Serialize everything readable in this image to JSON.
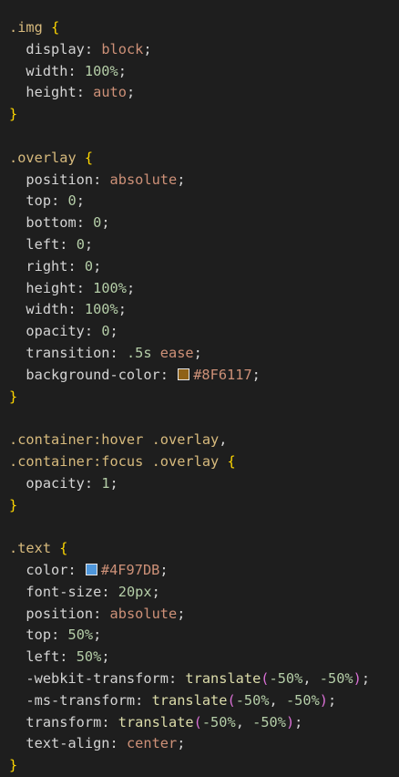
{
  "editor": {
    "lines": [
      [
        {
          "t": ".img",
          "c": "selector"
        },
        {
          "t": " ",
          "c": "punct"
        },
        {
          "t": "{",
          "c": "brace"
        }
      ],
      [
        {
          "t": "  display",
          "c": "prop-muted"
        },
        {
          "t": ": ",
          "c": "punct"
        },
        {
          "t": "block",
          "c": "kw"
        },
        {
          "t": ";",
          "c": "punct"
        }
      ],
      [
        {
          "t": "  width",
          "c": "prop-muted"
        },
        {
          "t": ": ",
          "c": "punct"
        },
        {
          "t": "100%",
          "c": "num"
        },
        {
          "t": ";",
          "c": "punct"
        }
      ],
      [
        {
          "t": "  height",
          "c": "prop-muted"
        },
        {
          "t": ": ",
          "c": "punct"
        },
        {
          "t": "auto",
          "c": "kw"
        },
        {
          "t": ";",
          "c": "punct"
        }
      ],
      [
        {
          "t": "}",
          "c": "brace"
        }
      ],
      [],
      [
        {
          "t": ".overlay",
          "c": "selector"
        },
        {
          "t": " ",
          "c": "punct"
        },
        {
          "t": "{",
          "c": "brace"
        }
      ],
      [
        {
          "t": "  position",
          "c": "prop-muted"
        },
        {
          "t": ": ",
          "c": "punct"
        },
        {
          "t": "absolute",
          "c": "kw"
        },
        {
          "t": ";",
          "c": "punct"
        }
      ],
      [
        {
          "t": "  top",
          "c": "prop-muted"
        },
        {
          "t": ": ",
          "c": "punct"
        },
        {
          "t": "0",
          "c": "num"
        },
        {
          "t": ";",
          "c": "punct"
        }
      ],
      [
        {
          "t": "  bottom",
          "c": "prop-muted"
        },
        {
          "t": ": ",
          "c": "punct"
        },
        {
          "t": "0",
          "c": "num"
        },
        {
          "t": ";",
          "c": "punct"
        }
      ],
      [
        {
          "t": "  left",
          "c": "prop-muted"
        },
        {
          "t": ": ",
          "c": "punct"
        },
        {
          "t": "0",
          "c": "num"
        },
        {
          "t": ";",
          "c": "punct"
        }
      ],
      [
        {
          "t": "  right",
          "c": "prop-muted"
        },
        {
          "t": ": ",
          "c": "punct"
        },
        {
          "t": "0",
          "c": "num"
        },
        {
          "t": ";",
          "c": "punct"
        }
      ],
      [
        {
          "t": "  height",
          "c": "prop-muted"
        },
        {
          "t": ": ",
          "c": "punct"
        },
        {
          "t": "100%",
          "c": "num"
        },
        {
          "t": ";",
          "c": "punct"
        }
      ],
      [
        {
          "t": "  width",
          "c": "prop-muted"
        },
        {
          "t": ": ",
          "c": "punct"
        },
        {
          "t": "100%",
          "c": "num"
        },
        {
          "t": ";",
          "c": "punct"
        }
      ],
      [
        {
          "t": "  opacity",
          "c": "prop-muted"
        },
        {
          "t": ": ",
          "c": "punct"
        },
        {
          "t": "0",
          "c": "num"
        },
        {
          "t": ";",
          "c": "punct"
        }
      ],
      [
        {
          "t": "  transition",
          "c": "prop-muted"
        },
        {
          "t": ": ",
          "c": "punct"
        },
        {
          "t": ".5s",
          "c": "num"
        },
        {
          "t": " ",
          "c": "punct"
        },
        {
          "t": "ease",
          "c": "kw"
        },
        {
          "t": ";",
          "c": "punct"
        }
      ],
      [
        {
          "t": "  background-color",
          "c": "prop-muted"
        },
        {
          "t": ": ",
          "c": "punct"
        },
        {
          "swatch": "#8F6117"
        },
        {
          "t": "#8F6117",
          "c": "hex"
        },
        {
          "t": ";",
          "c": "punct"
        }
      ],
      [
        {
          "t": "}",
          "c": "brace"
        }
      ],
      [],
      [
        {
          "t": ".container:hover",
          "c": "selector"
        },
        {
          "t": " ",
          "c": "punct"
        },
        {
          "t": ".overlay",
          "c": "selector"
        },
        {
          "t": ",",
          "c": "punct"
        }
      ],
      [
        {
          "t": ".container:focus",
          "c": "selector"
        },
        {
          "t": " ",
          "c": "punct"
        },
        {
          "t": ".overlay",
          "c": "selector"
        },
        {
          "t": " ",
          "c": "punct"
        },
        {
          "t": "{",
          "c": "brace"
        }
      ],
      [
        {
          "t": "  opacity",
          "c": "prop-muted"
        },
        {
          "t": ": ",
          "c": "punct"
        },
        {
          "t": "1",
          "c": "num"
        },
        {
          "t": ";",
          "c": "punct"
        }
      ],
      [
        {
          "t": "}",
          "c": "brace"
        }
      ],
      [],
      [
        {
          "t": ".text",
          "c": "selector"
        },
        {
          "t": " ",
          "c": "punct"
        },
        {
          "t": "{",
          "c": "brace"
        }
      ],
      [
        {
          "t": "  color",
          "c": "prop-muted"
        },
        {
          "t": ": ",
          "c": "punct"
        },
        {
          "swatch": "#4F97DB"
        },
        {
          "t": "#4F97DB",
          "c": "hex"
        },
        {
          "t": ";",
          "c": "punct"
        }
      ],
      [
        {
          "t": "  font-size",
          "c": "prop-muted"
        },
        {
          "t": ": ",
          "c": "punct"
        },
        {
          "t": "20px",
          "c": "num"
        },
        {
          "t": ";",
          "c": "punct"
        }
      ],
      [
        {
          "t": "  position",
          "c": "prop-muted"
        },
        {
          "t": ": ",
          "c": "punct"
        },
        {
          "t": "absolute",
          "c": "kw"
        },
        {
          "t": ";",
          "c": "punct"
        }
      ],
      [
        {
          "t": "  top",
          "c": "prop-muted"
        },
        {
          "t": ": ",
          "c": "punct"
        },
        {
          "t": "50%",
          "c": "num"
        },
        {
          "t": ";",
          "c": "punct"
        }
      ],
      [
        {
          "t": "  left",
          "c": "prop-muted"
        },
        {
          "t": ": ",
          "c": "punct"
        },
        {
          "t": "50%",
          "c": "num"
        },
        {
          "t": ";",
          "c": "punct"
        }
      ],
      [
        {
          "t": "  -webkit-transform",
          "c": "prop-muted"
        },
        {
          "t": ": ",
          "c": "punct"
        },
        {
          "t": "translate",
          "c": "fn"
        },
        {
          "t": "(",
          "c": "paren"
        },
        {
          "t": "-50%",
          "c": "num"
        },
        {
          "t": ", ",
          "c": "punct"
        },
        {
          "t": "-50%",
          "c": "num"
        },
        {
          "t": ")",
          "c": "paren"
        },
        {
          "t": ";",
          "c": "punct"
        }
      ],
      [
        {
          "t": "  -ms-transform",
          "c": "prop-muted"
        },
        {
          "t": ": ",
          "c": "punct"
        },
        {
          "t": "translate",
          "c": "fn"
        },
        {
          "t": "(",
          "c": "paren"
        },
        {
          "t": "-50%",
          "c": "num"
        },
        {
          "t": ", ",
          "c": "punct"
        },
        {
          "t": "-50%",
          "c": "num"
        },
        {
          "t": ")",
          "c": "paren"
        },
        {
          "t": ";",
          "c": "punct"
        }
      ],
      [
        {
          "t": "  transform",
          "c": "prop-muted"
        },
        {
          "t": ": ",
          "c": "punct"
        },
        {
          "t": "translate",
          "c": "fn"
        },
        {
          "t": "(",
          "c": "paren"
        },
        {
          "t": "-50%",
          "c": "num"
        },
        {
          "t": ", ",
          "c": "punct"
        },
        {
          "t": "-50%",
          "c": "num"
        },
        {
          "t": ")",
          "c": "paren"
        },
        {
          "t": ";",
          "c": "punct"
        }
      ],
      [
        {
          "t": "  text-align",
          "c": "prop-muted"
        },
        {
          "t": ": ",
          "c": "punct"
        },
        {
          "t": "center",
          "c": "kw"
        },
        {
          "t": ";",
          "c": "punct"
        }
      ],
      [
        {
          "t": "}",
          "c": "brace"
        }
      ]
    ]
  }
}
